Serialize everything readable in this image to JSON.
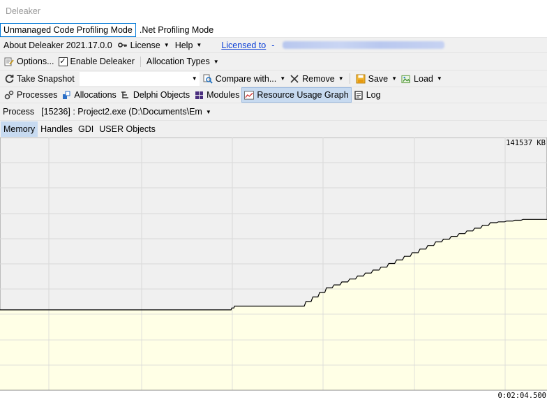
{
  "window": {
    "title": "Deleaker"
  },
  "modes": {
    "unmanaged": "Unmanaged Code Profiling Mode",
    "dotnet": ".Net Profiling Mode"
  },
  "menu": {
    "about": "About Deleaker 2021.17.0.0",
    "license": "License",
    "help": "Help",
    "licensed_to": "Licensed to"
  },
  "options": {
    "options_label": "Options...",
    "enable_label": "Enable Deleaker",
    "enable_checked": true,
    "allocation_types": "Allocation Types"
  },
  "snapshot_toolbar": {
    "take_snapshot": "Take Snapshot",
    "snapshot_value": "",
    "compare": "Compare with...",
    "remove": "Remove",
    "save": "Save",
    "load": "Load"
  },
  "views": {
    "processes": "Processes",
    "allocations": "Allocations",
    "delphi_objects": "Delphi Objects",
    "modules": "Modules",
    "resource_graph": "Resource Usage Graph",
    "log": "Log"
  },
  "process": {
    "label": "Process",
    "value": "[15236] : Project2.exe (D:\\Documents\\Em"
  },
  "subtabs": {
    "memory": "Memory",
    "handles": "Handles",
    "gdi": "GDI",
    "user_objects": "USER Objects"
  },
  "graph": {
    "max_label": "141537 KB",
    "time_label": "0:02:04.500",
    "max_value_kb": 141537,
    "fill_color": "#ffffe6",
    "line_color": "#000000",
    "grid_color": "#d9d9d9",
    "bg_color": "#f0f0f0"
  },
  "chart_data": {
    "type": "area",
    "x": [
      0,
      0.42,
      0.43,
      0.55,
      0.6,
      0.7,
      0.8,
      0.9,
      0.96,
      1.0
    ],
    "y": [
      0.318,
      0.318,
      0.333,
      0.333,
      0.405,
      0.487,
      0.587,
      0.663,
      0.676,
      0.676
    ],
    "series": [
      {
        "values": [
          0.318,
          0.318,
          0.333,
          0.333,
          0.405,
          0.487,
          0.587,
          0.663,
          0.676,
          0.676
        ]
      }
    ],
    "title": "",
    "xlabel": "",
    "ylabel": "",
    "ylim": [
      0,
      1
    ],
    "grid": true
  }
}
